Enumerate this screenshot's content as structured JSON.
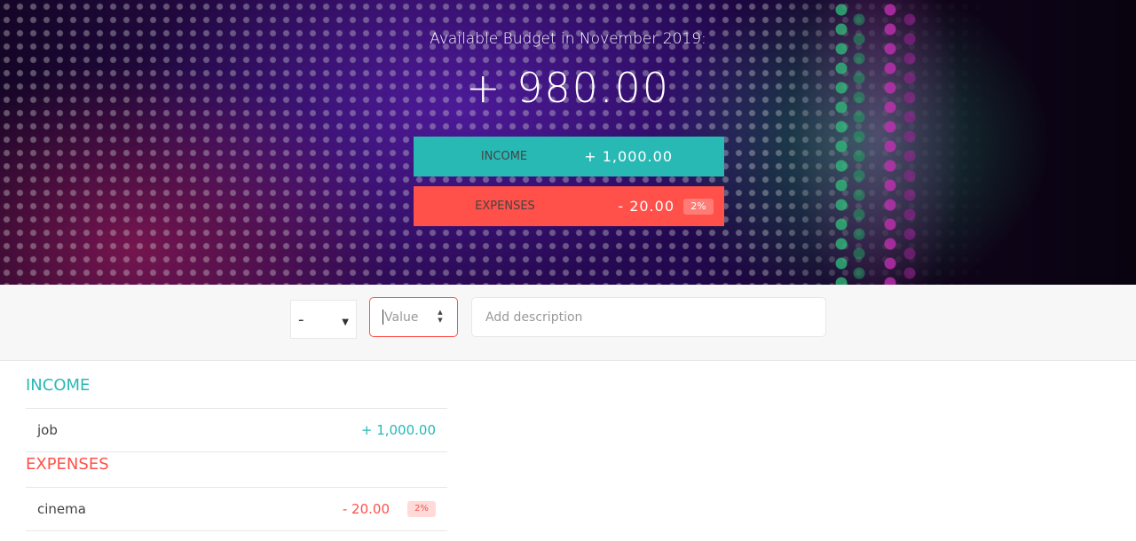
{
  "budget": {
    "title": "Available Budget in November 2019:",
    "value": "+ 980.00",
    "income": {
      "label": "Income",
      "value": "+ 1,000.00"
    },
    "expenses": {
      "label": "Expenses",
      "value": "- 20.00",
      "percentage": "2%"
    }
  },
  "add_form": {
    "type_selected": "-",
    "value_placeholder": "Value",
    "description_placeholder": "Add description"
  },
  "income_list": {
    "title": "Income",
    "items": [
      {
        "description": "job",
        "value": "+ 1,000.00"
      }
    ]
  },
  "expenses_list": {
    "title": "Expenses",
    "items": [
      {
        "description": "cinema",
        "value": "- 20.00",
        "percentage": "2%"
      }
    ]
  },
  "colors": {
    "income": "#28b9b5",
    "expenses": "#ff5049",
    "background": "#f7f7f7"
  },
  "icons": {
    "type_select": "chevron-down-icon",
    "value_stepper": "spinner-arrows-icon"
  }
}
